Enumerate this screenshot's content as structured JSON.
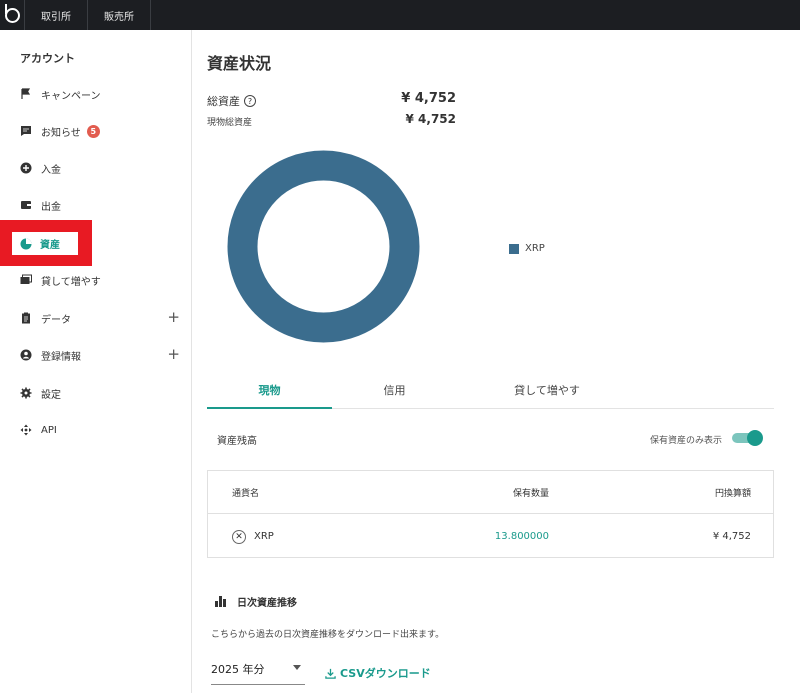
{
  "topbar": {
    "tabs": [
      "取引所",
      "販売所"
    ]
  },
  "sidebar": {
    "title": "アカウント",
    "items": [
      {
        "label": "キャンペーン",
        "icon": "flag-icon"
      },
      {
        "label": "お知らせ",
        "icon": "message-icon",
        "badge": "5"
      },
      {
        "label": "入金",
        "icon": "plus-circle-icon"
      },
      {
        "label": "出金",
        "icon": "wallet-icon"
      },
      {
        "label": "資産",
        "icon": "pie-chart-icon",
        "active": true
      },
      {
        "label": "貸して増やす",
        "icon": "lend-icon"
      },
      {
        "label": "データ",
        "icon": "clipboard-icon",
        "expand": "+"
      },
      {
        "label": "登録情報",
        "icon": "user-icon",
        "expand": "+"
      },
      {
        "label": "設定",
        "icon": "gear-icon"
      },
      {
        "label": "API",
        "icon": "api-icon"
      }
    ]
  },
  "main": {
    "title": "資産状況",
    "total_label": "総資産",
    "total_value": "¥ 4,752",
    "spot_label": "現物総資産",
    "spot_value": "¥ 4,752",
    "tabs": [
      "現物",
      "信用",
      "貸して増やす"
    ],
    "balance_title": "資産残高",
    "toggle_label": "保有資産のみ表示",
    "table": {
      "headers": [
        "通貨名",
        "保有数量",
        "円換算額"
      ],
      "rows": [
        {
          "name": "XRP",
          "qty": "13.800000",
          "jpy": "¥ 4,752"
        }
      ]
    },
    "daily_title": "日次資産推移",
    "daily_desc": "こちらから過去の日次資産推移をダウンロード出来ます。",
    "year_value": "2025 年分",
    "csv_label": "CSVダウンロード"
  },
  "chart_data": {
    "type": "pie",
    "categories": [
      "XRP"
    ],
    "values": [
      4752
    ],
    "colors": [
      "#3b6d8e"
    ],
    "legend": "right"
  },
  "colors": {
    "accent": "#1a9a8c",
    "badge": "#e25c4f",
    "highlight": "#e81a23",
    "topbar": "#1c1e22"
  }
}
